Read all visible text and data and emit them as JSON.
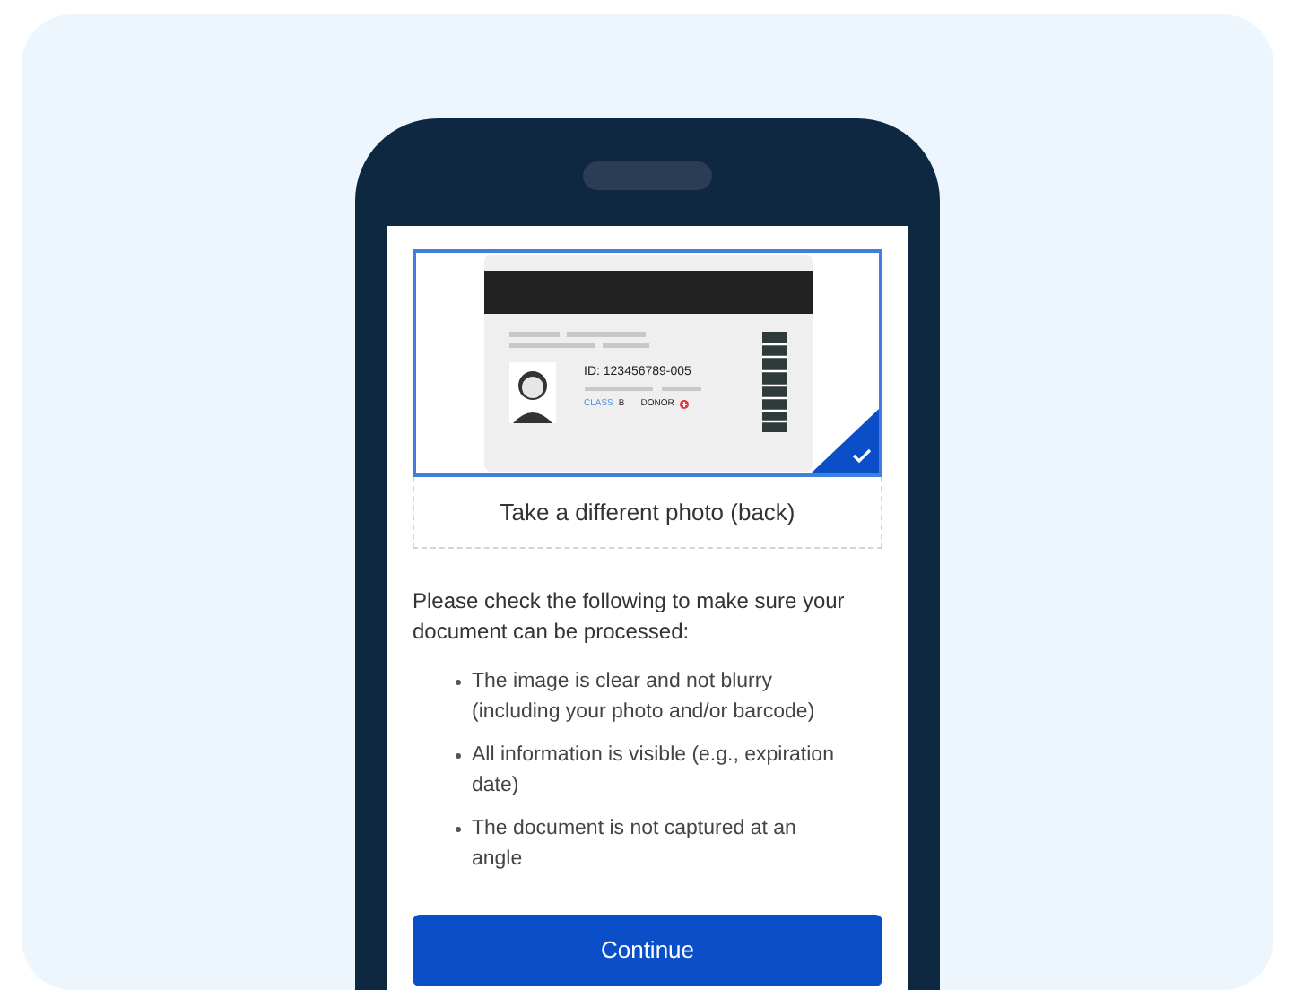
{
  "photo": {
    "selected": true,
    "card": {
      "id_text": "ID: 123456789-005",
      "class_label": "CLASS",
      "class_value": "B",
      "donor_label": "DONOR"
    },
    "caption": "Take a different photo (back)"
  },
  "instructions": {
    "intro": "Please check the following to make sure your document can be processed:",
    "items": [
      "The image is clear and not blurry (including your photo and/or barcode)",
      "All information is visible (e.g., expiration date)",
      "The document is not captured at an angle"
    ]
  },
  "button": {
    "label": "Continue"
  }
}
